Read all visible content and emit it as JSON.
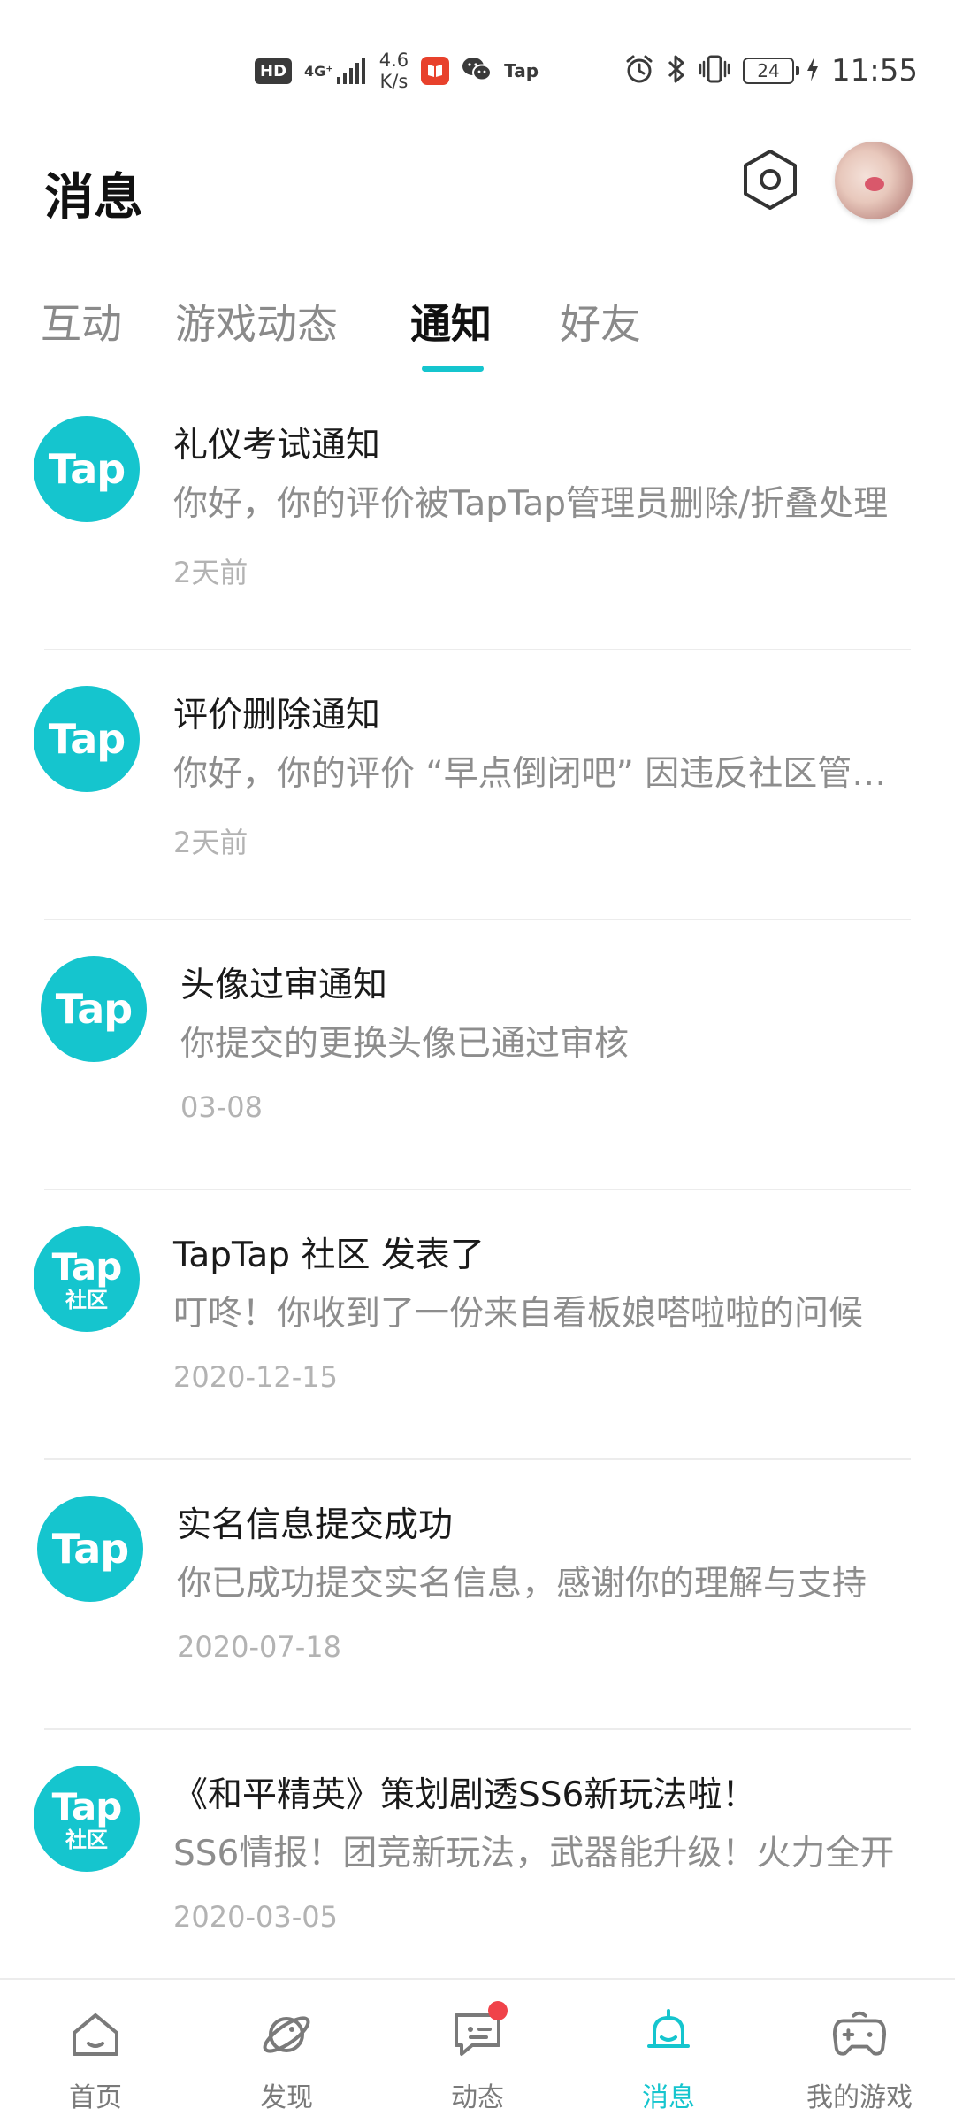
{
  "status_bar": {
    "hd": "HD",
    "network_gen": "4G⁺",
    "speed_value": "4.6",
    "speed_unit": "K/s",
    "tap_mini": "Tap",
    "battery": "24",
    "time": "11:55"
  },
  "header": {
    "title": "消息"
  },
  "tabs": [
    {
      "label": "互动"
    },
    {
      "label": "游戏动态"
    },
    {
      "label": "通知"
    },
    {
      "label": "好友"
    }
  ],
  "active_tab": "通知",
  "messages": [
    {
      "logo_text": "Tap",
      "title": "礼仪考试通知",
      "body": "你好，你的评价被TapTap管理员删除/折叠处理",
      "time": "2天前"
    },
    {
      "logo_text": "Tap",
      "title": "评价删除通知",
      "body": "你好，你的评价 “早点倒闭吧” 因违反社区管理规定",
      "time": "2天前"
    },
    {
      "logo_text": "Tap",
      "title": "头像过审通知",
      "body": "你提交的更换头像已通过审核",
      "time": "03-08"
    },
    {
      "logo_text": "Tap",
      "logo_sub": "社区",
      "title": "TapTap 社区 发表了",
      "body": "叮咚！你收到了一份来自看板娘嗒啦啦的问候",
      "time": "2020-12-15"
    },
    {
      "logo_text": "Tap",
      "title": "实名信息提交成功",
      "body": "你已成功提交实名信息，感谢你的理解与支持",
      "time": "2020-07-18"
    },
    {
      "logo_text": "Tap",
      "logo_sub": "社区",
      "title": "《和平精英》策划剧透SS6新玩法啦！",
      "body": "SS6情报！团竞新玩法，武器能升级！火力全开",
      "time": "2020-03-05"
    }
  ],
  "bottom_nav": [
    {
      "label": "首页",
      "icon": "home-icon"
    },
    {
      "label": "发现",
      "icon": "planet-icon"
    },
    {
      "label": "动态",
      "icon": "chat-icon"
    },
    {
      "label": "消息",
      "icon": "bell-icon"
    },
    {
      "label": "我的游戏",
      "icon": "gamepad-icon"
    }
  ],
  "colors": {
    "accent": "#15C5CE",
    "badge": "#F0434A"
  }
}
